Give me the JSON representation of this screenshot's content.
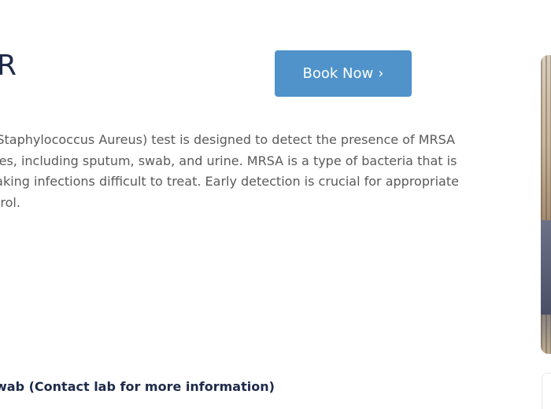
{
  "heading": {
    "title_fragment": "R"
  },
  "cta": {
    "book_label": "Book Now",
    "chevron": "›"
  },
  "description": {
    "lines": [
      "t Staphylococcus Aureus) test is designed to detect the presence of MRSA",
      "ples, including sputum, swab, and urine. MRSA is a type of bacteria that is",
      "naking infections difficult to treat. Early detection is crucial for appropriate",
      "ntrol."
    ]
  },
  "sample": {
    "text": "wab (Contact lab for more information)"
  },
  "colors": {
    "button_bg": "#4f93ca",
    "heading": "#1e2a4a",
    "body_text": "#5a5a5a"
  },
  "icons": {
    "button_chevron": "chevron-right-icon"
  }
}
